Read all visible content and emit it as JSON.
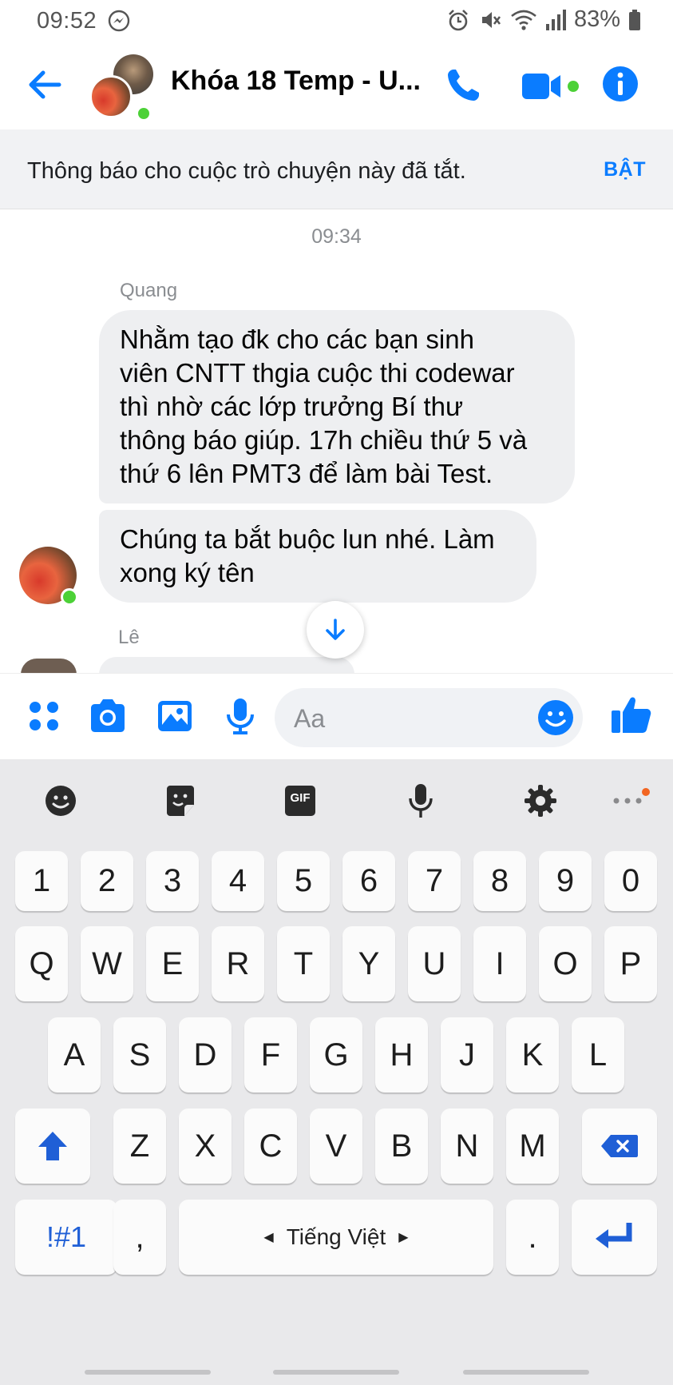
{
  "status_bar": {
    "time": "09:52",
    "battery": "83%",
    "icons": [
      "messenger-icon",
      "alarm-icon",
      "mute-icon",
      "wifi-icon",
      "signal-icon",
      "battery-icon"
    ]
  },
  "header": {
    "title": "Khóa 18 Temp - U...",
    "icons": [
      "back-arrow-icon",
      "phone-icon",
      "video-icon",
      "info-icon"
    ]
  },
  "notification": {
    "text": "Thông báo cho cuộc trò chuyện này đã tắt.",
    "action": "BẬT"
  },
  "conversation": {
    "timestamp": "09:34",
    "messages": [
      {
        "sender": "Quang",
        "lines": [
          "Nhằm tạo đk cho các bạn sinh",
          "viên CNTT thgia cuộc thi codewar",
          "thì nhờ các lớp trưởng Bí thư",
          "thông báo giúp. 17h chiều thứ 5 và",
          "thứ 6 lên PMT3 để làm bài Test."
        ]
      },
      {
        "sender": "",
        "lines": [
          "Chúng ta bắt buộc lun nhé. Làm",
          "xong ký tên"
        ]
      },
      {
        "sender": "Lê",
        "lines": []
      }
    ]
  },
  "composer": {
    "placeholder": "Aa",
    "icons": [
      "menu-dots-icon",
      "camera-icon",
      "gallery-icon",
      "microphone-icon",
      "emoji-icon",
      "like-icon"
    ]
  },
  "keyboard": {
    "toolbar": [
      "emoji-icon",
      "sticker-icon",
      "gif-icon",
      "voice-input-icon",
      "settings-icon",
      "more-icon"
    ],
    "gif_label": "GIF",
    "row_numbers": [
      "1",
      "2",
      "3",
      "4",
      "5",
      "6",
      "7",
      "8",
      "9",
      "0"
    ],
    "row_top": [
      "Q",
      "W",
      "E",
      "R",
      "T",
      "Y",
      "U",
      "I",
      "O",
      "P"
    ],
    "row_middle": [
      "A",
      "S",
      "D",
      "F",
      "G",
      "H",
      "J",
      "K",
      "L"
    ],
    "row_bottom": [
      "Z",
      "X",
      "C",
      "V",
      "B",
      "N",
      "M"
    ],
    "symbols_label": "!#1",
    "comma_label": ",",
    "space_label": "Tiếng Việt",
    "period_label": ".",
    "accent_color": "#1f5fd6"
  }
}
